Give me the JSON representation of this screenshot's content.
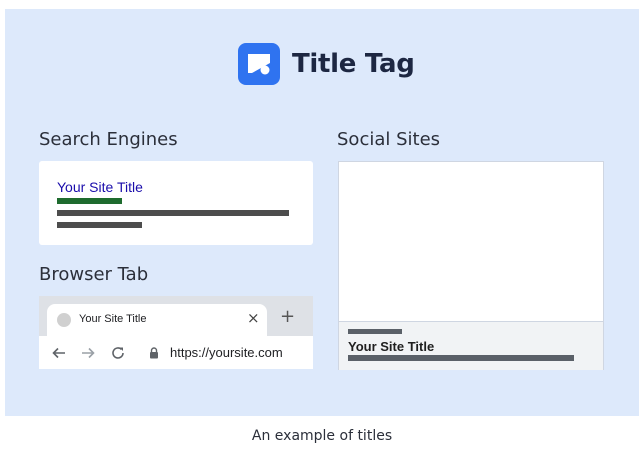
{
  "brand": {
    "title": "Title Tag",
    "icon": "title-tag-logo-icon",
    "accent": "#2f73f0"
  },
  "search_engines": {
    "heading": "Search Engines",
    "result_title": "Your Site Title",
    "link_color": "#1a0dab",
    "url_bar_color": "#1e6b2e",
    "text_bar_color": "#4d4d4d"
  },
  "browser_tab": {
    "heading": "Browser Tab",
    "tab_title": "Your Site Title",
    "close_icon": "×",
    "new_tab_icon": "+",
    "url": "https://yoursite.com"
  },
  "social_sites": {
    "heading": "Social Sites",
    "post_title": "Your Site Title"
  },
  "caption": "An example of titles"
}
